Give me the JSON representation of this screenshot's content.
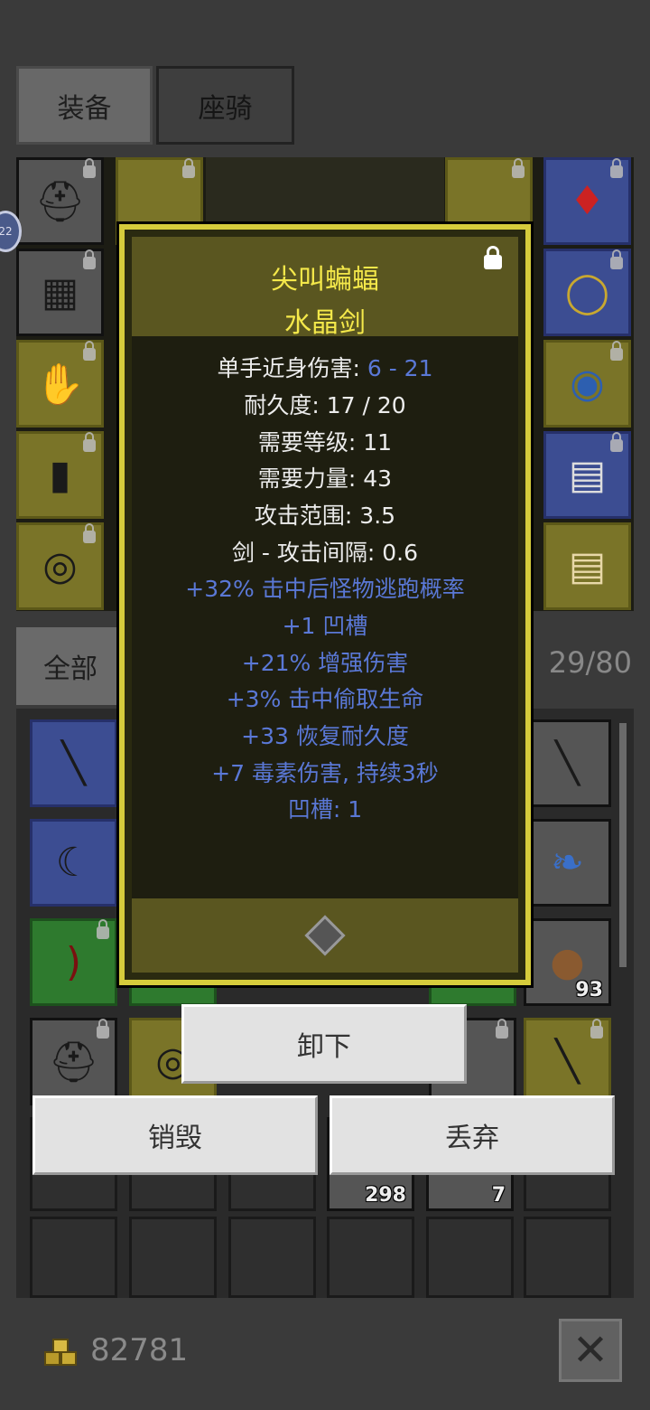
{
  "top_tabs": {
    "equipment": "装备",
    "mount": "座骑"
  },
  "equipment": {
    "left_slots": [
      {
        "icon": "horned-helmet-icon",
        "rarity": "gray"
      },
      {
        "icon": "chest-armor-icon",
        "rarity": "gray"
      },
      {
        "icon": "gauntlet-icon",
        "rarity": "gold"
      },
      {
        "icon": "boots-icon",
        "rarity": "gold"
      },
      {
        "icon": "belt-icon",
        "rarity": "gold"
      }
    ],
    "right_slots": [
      {
        "icon": "amulet-icon",
        "rarity": "blue"
      },
      {
        "icon": "gold-ring-icon",
        "rarity": "blue"
      },
      {
        "icon": "sapphire-ring-icon",
        "rarity": "gold"
      },
      {
        "icon": "scroll-map-icon",
        "rarity": "blue"
      },
      {
        "icon": "scroll-icon",
        "rarity": "gold"
      }
    ],
    "avatar_level": "22"
  },
  "inventory": {
    "filter_tab": "全部",
    "count": "29/80",
    "quantities": {
      "stone": "93",
      "key1": "298",
      "key2": "7"
    }
  },
  "tooltip": {
    "name": "尖叫蝙蝠",
    "item_type": "水晶剑",
    "stats": [
      {
        "label": "单手近身伤害: ",
        "value": "6 - 21"
      },
      {
        "label": "耐久度: 17 / 20",
        "value": ""
      },
      {
        "label": "需要等级: 11",
        "value": ""
      },
      {
        "label": "需要力量: 43",
        "value": ""
      },
      {
        "label": "攻击范围: 3.5",
        "value": ""
      },
      {
        "label": "剑 - 攻击间隔: 0.6",
        "value": ""
      }
    ],
    "affixes": [
      "+32% 击中后怪物逃跑概率",
      "+1 凹槽",
      "+21% 增强伤害",
      "+3% 击中偷取生命",
      "+33 恢复耐久度",
      "+7 毒素伤害, 持续3秒",
      "凹槽: 1"
    ]
  },
  "actions": {
    "unequip": "卸下",
    "destroy": "销毁",
    "drop": "丢弃"
  },
  "footer": {
    "gold": "82781"
  },
  "colors": {
    "item_name": "#f4e84a",
    "affix_blue": "#5a78d6",
    "tooltip_border": "#d6cc3c"
  }
}
